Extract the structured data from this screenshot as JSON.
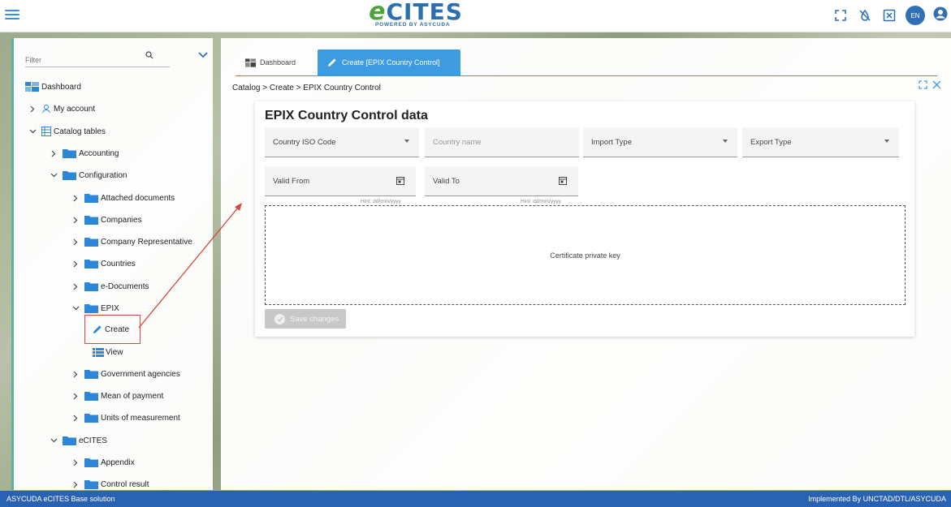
{
  "header": {
    "logo_main": "CITES",
    "logo_e": "e",
    "logo_sub": "POWERED BY ASYCUDA",
    "language": "EN"
  },
  "sidebar": {
    "filter_placeholder": "Filter",
    "items": [
      {
        "label": "Dashboard",
        "icon": "dashboard-icon"
      },
      {
        "label": "My account",
        "icon": "user-icon"
      },
      {
        "label": "Catalog tables",
        "icon": "table-icon"
      },
      {
        "label": "Accounting",
        "icon": "folder-icon"
      },
      {
        "label": "Configuration",
        "icon": "folder-icon"
      },
      {
        "label": "Attached documents",
        "icon": "folder-icon"
      },
      {
        "label": "Companies",
        "icon": "folder-icon"
      },
      {
        "label": "Company Representative",
        "icon": "folder-icon"
      },
      {
        "label": "Countries",
        "icon": "folder-icon"
      },
      {
        "label": "e-Documents",
        "icon": "folder-icon"
      },
      {
        "label": "EPIX",
        "icon": "folder-icon"
      },
      {
        "label": "Create",
        "icon": "pencil-icon"
      },
      {
        "label": "View",
        "icon": "list-icon"
      },
      {
        "label": "Government agencies",
        "icon": "folder-icon"
      },
      {
        "label": "Mean of payment",
        "icon": "folder-icon"
      },
      {
        "label": "Units of measurement",
        "icon": "folder-icon"
      },
      {
        "label": "eCITES",
        "icon": "folder-icon"
      },
      {
        "label": "Appendix",
        "icon": "folder-icon"
      },
      {
        "label": "Control result",
        "icon": "folder-icon"
      }
    ]
  },
  "main": {
    "tabs": [
      {
        "label": "Dashboard",
        "icon": "dashboard-icon",
        "active": false
      },
      {
        "label": "Create [EPIX Country Control]",
        "icon": "pencil-icon",
        "active": true
      }
    ],
    "breadcrumb": "Catalog > Create > EPIX Country Control",
    "form": {
      "title": "EPIX Country Control data",
      "country_iso_code": "Country ISO Code",
      "country_name_placeholder": "Country name",
      "import_type": "Import Type",
      "export_type": "Export Type",
      "valid_from": "Valid From",
      "valid_to": "Valid To",
      "date_hint": "Hint: dd/mm/yyyy",
      "certificate_key": "Certificate private key",
      "save_label": "Save changes"
    }
  },
  "footer": {
    "left": "ASYCUDA eCITES Base solution",
    "right": "Implemented By UNCTAD/DTL/ASYCUDA"
  },
  "colors": {
    "accent": "#3f9be0",
    "brand_blue": "#2b6fb3",
    "brand_green": "#4aa538",
    "footer": "#2a62b3",
    "annotation": "#d6483a",
    "folder": "#2e86d8"
  }
}
